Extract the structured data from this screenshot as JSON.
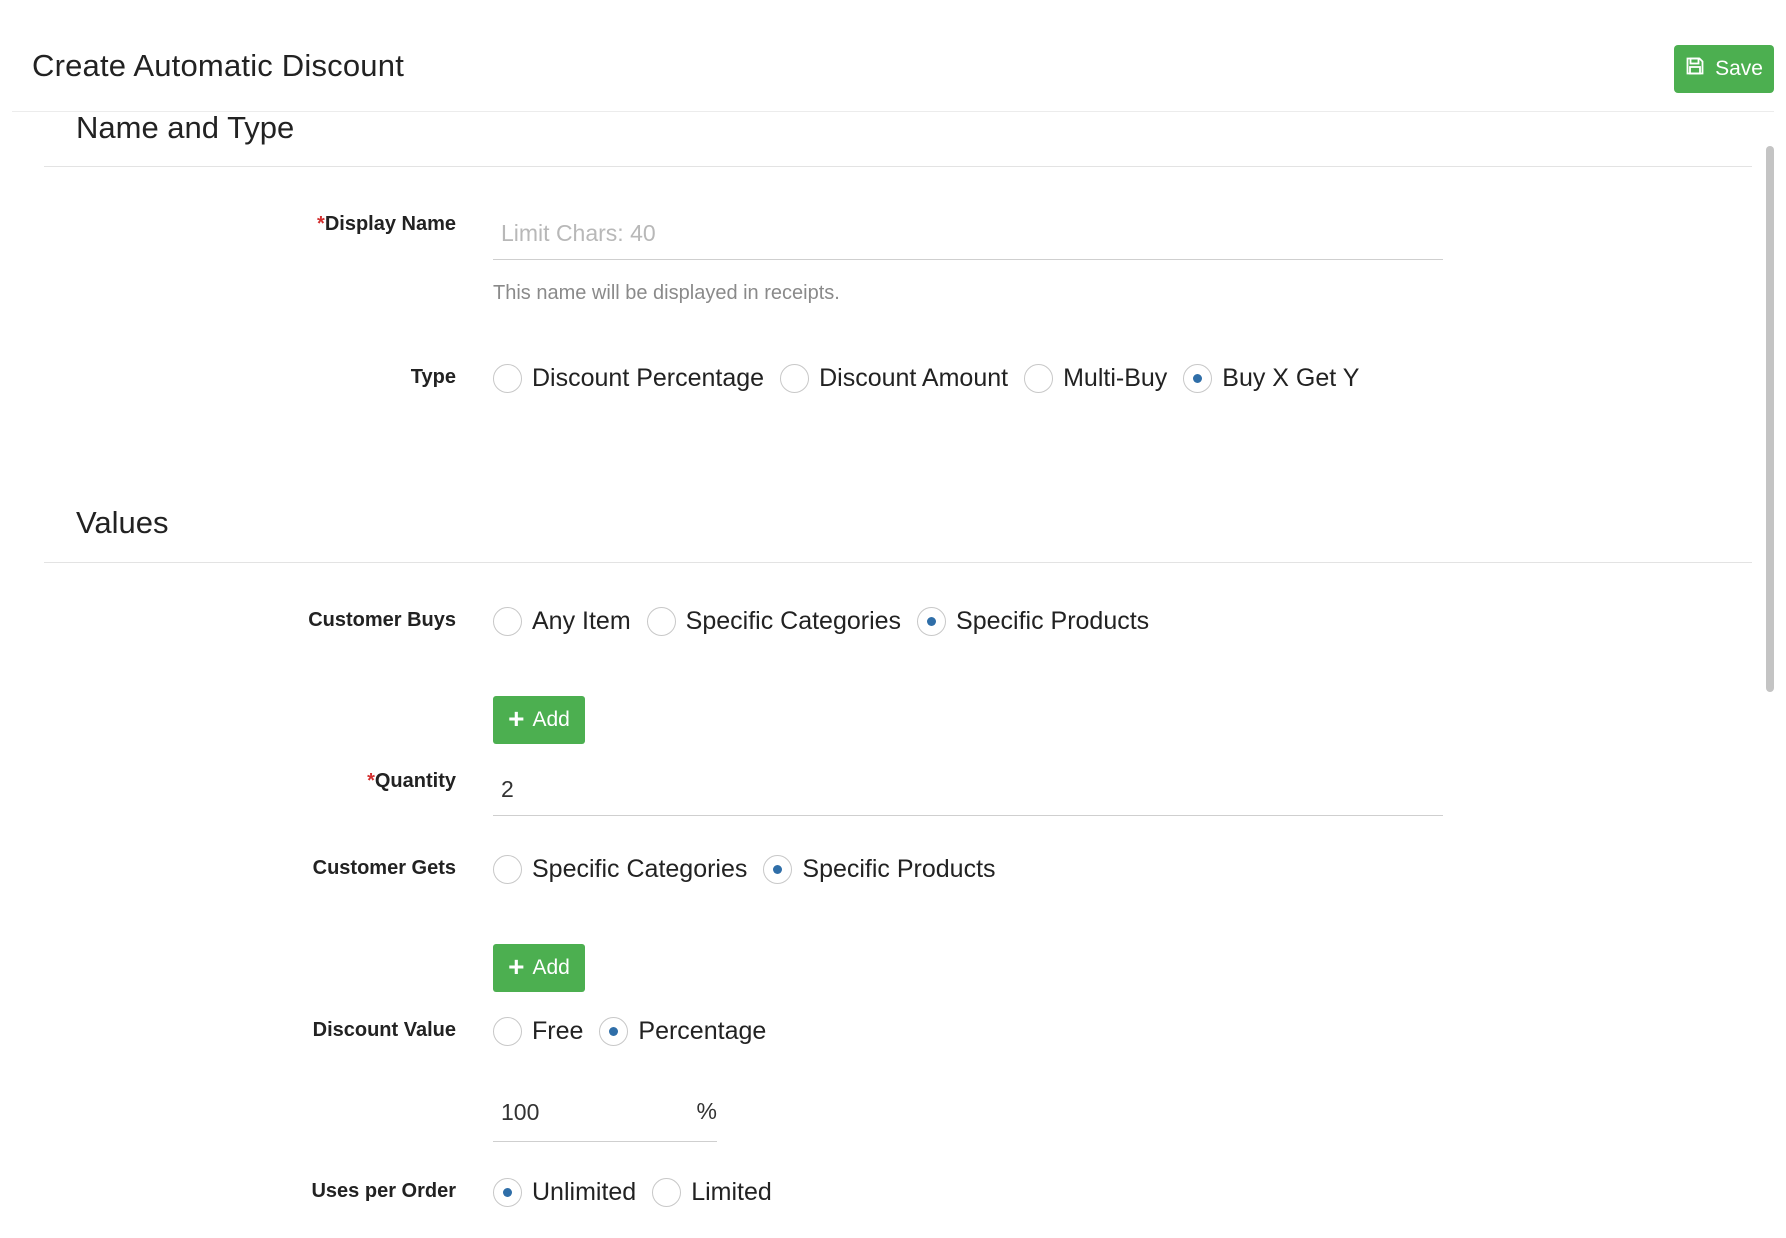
{
  "header": {
    "title": "Create Automatic Discount",
    "save_label": "Save"
  },
  "section_name_type": {
    "title": "Name and Type",
    "display_name": {
      "label": "Display Name",
      "required_mark": "*",
      "value": "",
      "placeholder": "Limit Chars: 40",
      "help": "This name will be displayed in receipts."
    },
    "type": {
      "label": "Type",
      "options": [
        "Discount Percentage",
        "Discount Amount",
        "Multi-Buy",
        "Buy X Get Y"
      ],
      "selected": "Buy X Get Y"
    }
  },
  "section_values": {
    "title": "Values",
    "customer_buys": {
      "label": "Customer Buys",
      "options": [
        "Any Item",
        "Specific Categories",
        "Specific Products"
      ],
      "selected": "Specific Products",
      "add_label": "Add"
    },
    "quantity": {
      "label": "Quantity",
      "required_mark": "*",
      "value": "2"
    },
    "customer_gets": {
      "label": "Customer Gets",
      "options": [
        "Specific Categories",
        "Specific Products"
      ],
      "selected": "Specific Products",
      "add_label": "Add"
    },
    "discount_value": {
      "label": "Discount Value",
      "options": [
        "Free",
        "Percentage"
      ],
      "selected": "Percentage",
      "amount": "100",
      "unit": "%"
    },
    "uses_per_order": {
      "label": "Uses per Order",
      "options": [
        "Unlimited",
        "Limited"
      ],
      "selected": "Unlimited"
    }
  },
  "colors": {
    "accent_green": "#4caf50",
    "radio_dot": "#2f6ea8",
    "required": "#d32f2f"
  },
  "icons": {
    "save": "floppy-disk-icon",
    "add": "plus-icon"
  }
}
